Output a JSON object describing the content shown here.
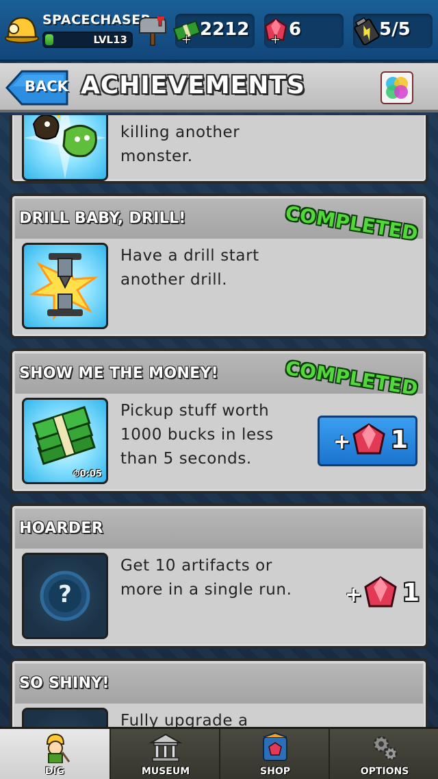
{
  "player": {
    "name": "SPACECHASER",
    "level": "LVL13",
    "xp_fraction": 0.1
  },
  "resources": {
    "cash": "2212",
    "gems": "6",
    "energy": "5/5"
  },
  "header": {
    "back_label": "BACK",
    "title": "ACHIEVEMENTS"
  },
  "achievements": [
    {
      "title": "",
      "description_lines": [
        "killing another",
        "monster."
      ],
      "completed": false
    },
    {
      "title": "DRILL BABY, DRILL!",
      "description_lines": [
        "Have a drill start",
        "another drill."
      ],
      "completed": true,
      "completed_label": "COMPLETED"
    },
    {
      "title": "SHOW ME THE MONEY!",
      "description_lines": [
        "Pickup stuff worth",
        "1000 bucks in less",
        "than 5 seconds."
      ],
      "completed": true,
      "completed_label": "COMPLETED",
      "timer_label": "0:05",
      "reward": {
        "plus": "+",
        "amount": "1",
        "claimable": true
      }
    },
    {
      "title": "HOARDER",
      "description_lines": [
        "Get 10 artifacts or",
        "more in a single run."
      ],
      "completed": false,
      "locked_icon": "?",
      "reward": {
        "plus": "+",
        "amount": "1",
        "claimable": false
      }
    },
    {
      "title": "SO SHINY!",
      "description_lines": [
        "Fully upgrade a"
      ],
      "completed": false
    }
  ],
  "nav": {
    "items": [
      {
        "label": "DIG",
        "icon": "miner-icon",
        "active": true
      },
      {
        "label": "MUSEUM",
        "icon": "museum-icon",
        "active": false
      },
      {
        "label": "SHOP",
        "icon": "shop-icon",
        "active": false
      },
      {
        "label": "OPTIONS",
        "icon": "gears-icon",
        "active": false
      }
    ]
  },
  "colors": {
    "topbar": "#155489",
    "completed_green": "#52d83a",
    "reward_blue": "#2a8ae2",
    "gem_red": "#e23a56"
  }
}
